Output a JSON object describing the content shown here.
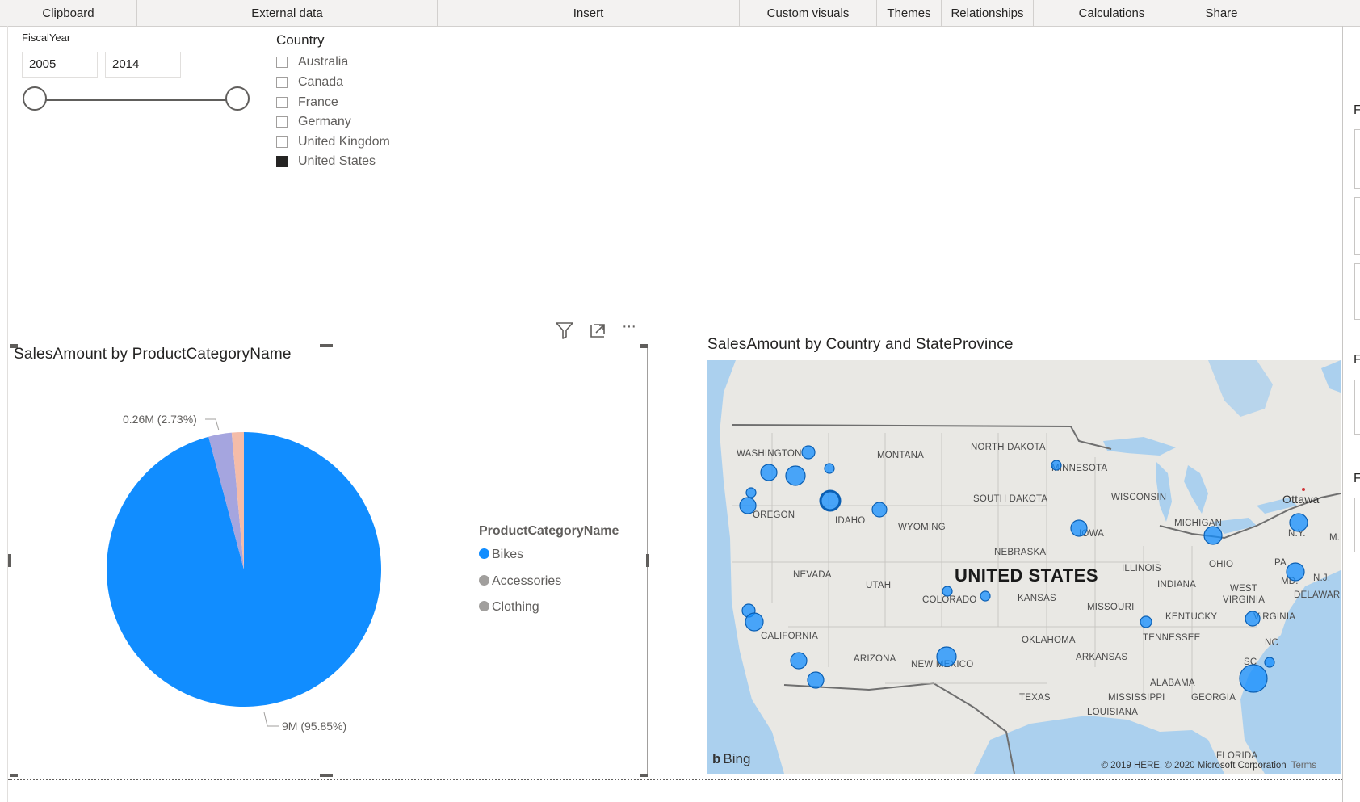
{
  "ribbon": {
    "groups": [
      "Clipboard",
      "External data",
      "Insert",
      "Custom visuals",
      "Themes",
      "Relationships",
      "Calculations",
      "Share"
    ]
  },
  "fiscal_year_slicer": {
    "title": "FiscalYear",
    "start": "2005",
    "end": "2014"
  },
  "country_slicer": {
    "title": "Country",
    "items": [
      {
        "label": "Australia",
        "checked": false
      },
      {
        "label": "Canada",
        "checked": false
      },
      {
        "label": "France",
        "checked": false
      },
      {
        "label": "Germany",
        "checked": false
      },
      {
        "label": "United Kingdom",
        "checked": false
      },
      {
        "label": "United States",
        "checked": true
      }
    ]
  },
  "visual_header": {
    "icons": [
      "filter-icon",
      "focus-mode-icon",
      "more-options-icon"
    ],
    "more_label": "···"
  },
  "pie_visual": {
    "title": "SalesAmount by ProductCategoryName",
    "small_label": "0.26M (2.73%)",
    "large_label": "9M (95.85%)",
    "legend_title": "ProductCategoryName"
  },
  "chart_data": {
    "type": "pie",
    "title": "SalesAmount by ProductCategoryName",
    "categories": [
      "Bikes",
      "Accessories",
      "Clothing"
    ],
    "values": [
      95.85,
      2.73,
      1.42
    ],
    "value_labels": [
      "9M (95.85%)",
      "0.26M (2.73%)",
      ""
    ],
    "colors": [
      "#118DFF",
      "#A5A5DF",
      "#F4BCA9"
    ],
    "legend_colors": [
      "#118DFF",
      "#A19F9D",
      "#A19F9D"
    ],
    "legend_title": "ProductCategoryName",
    "legend_position": "right"
  },
  "map_visual": {
    "title": "SalesAmount by Country and StateProvince",
    "country_label": "UNITED STATES",
    "city_label": "Ottawa",
    "bing_label": "Bing",
    "copyright": "© 2019 HERE, © 2020 Microsoft Corporation",
    "terms": "Terms",
    "region_labels": [
      "WASHINGTON",
      "MONTANA",
      "NORTH DAKOTA",
      "MINNESOTA",
      "OREGON",
      "IDAHO",
      "WYOMING",
      "SOUTH DAKOTA",
      "WISCONSIN",
      "MICHIGAN",
      "IOWA",
      "N.Y.",
      "NEBRASKA",
      "NEVADA",
      "UTAH",
      "ILLINOIS",
      "INDIANA",
      "OHIO",
      "PA",
      "MD.",
      "N.J.",
      "DELAWARE",
      "WEST VIRGINIA",
      "COLORADO",
      "KANSAS",
      "MISSOURI",
      "KENTUCKY",
      "VIRGINIA",
      "CALIFORNIA",
      "TENNESSEE",
      "OKLAHOMA",
      "NC",
      "ARIZONA",
      "NEW MEXICO",
      "ARKANSAS",
      "SC",
      "ALABAMA",
      "TEXAS",
      "MISSISSIPPI",
      "GEORGIA",
      "LOUISIANA",
      "FLORIDA",
      "M."
    ],
    "bubble_color": "#118DFF"
  },
  "right_panel": {
    "labels": [
      "F",
      "F",
      "F"
    ]
  }
}
